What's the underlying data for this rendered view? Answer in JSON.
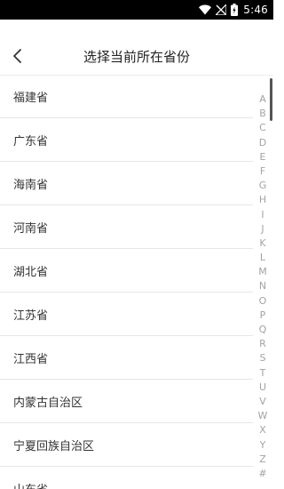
{
  "status_bar": {
    "time": "5:46",
    "icons": [
      "wifi-icon",
      "no-signal-icon",
      "battery-icon"
    ]
  },
  "header": {
    "back_icon": "chevron-left-icon",
    "title": "选择当前所在省份"
  },
  "provinces": [
    "福建省",
    "广东省",
    "海南省",
    "河南省",
    "湖北省",
    "江苏省",
    "江西省",
    "内蒙古自治区",
    "宁夏回族自治区",
    "山东省"
  ],
  "index_letters": [
    "A",
    "B",
    "C",
    "D",
    "E",
    "F",
    "G",
    "H",
    "I",
    "J",
    "K",
    "L",
    "M",
    "N",
    "O",
    "P",
    "Q",
    "R",
    "S",
    "T",
    "U",
    "V",
    "W",
    "X",
    "Y",
    "Z",
    "#"
  ],
  "colors": {
    "status_bar": "#000000",
    "background": "#ffffff",
    "divider": "#e6e6e6",
    "index_text": "#a3a3a3"
  }
}
